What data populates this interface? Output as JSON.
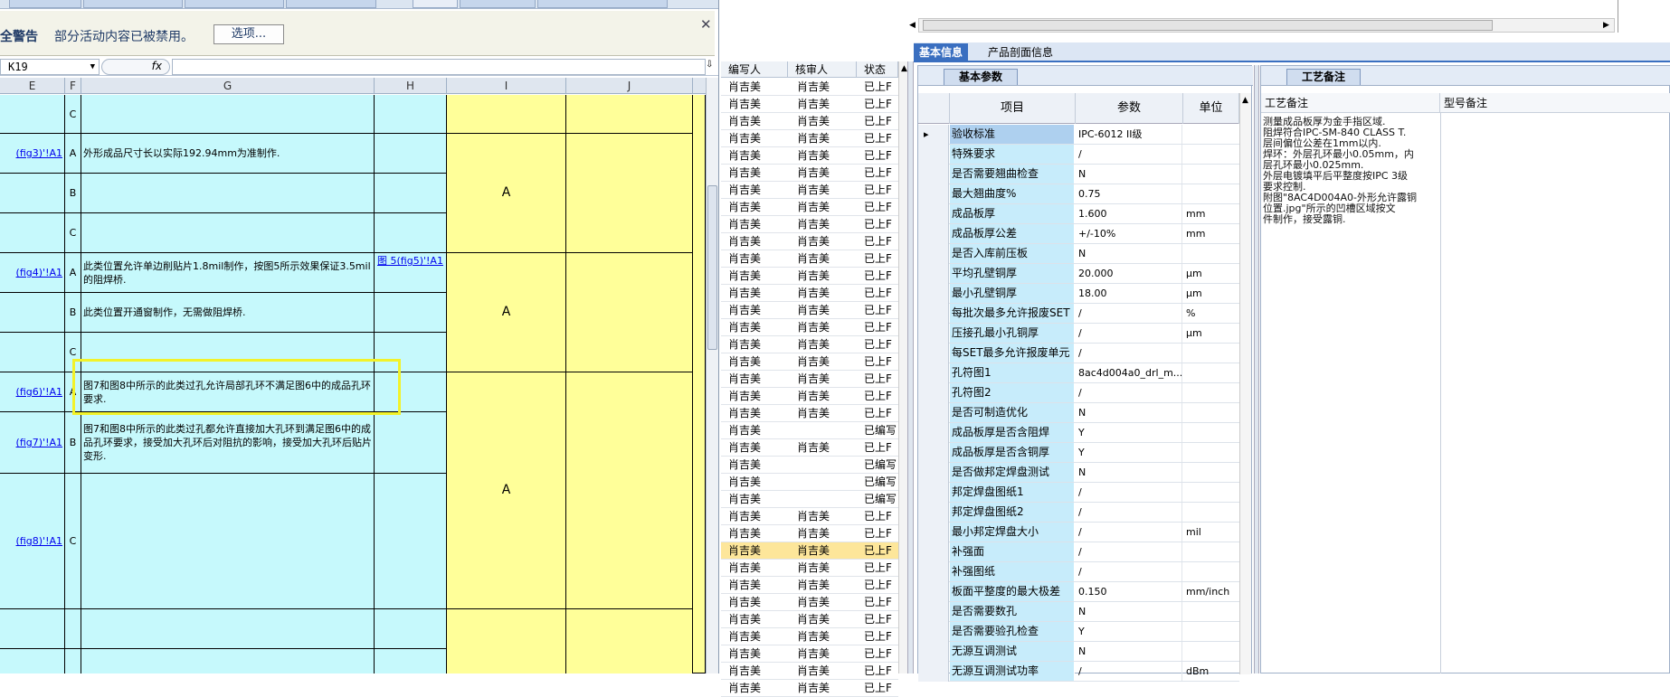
{
  "excel": {
    "security": {
      "title": "安全警告",
      "message": "部分活动内容已被禁用。",
      "options_label": "选项...",
      "close_glyph": "✕"
    },
    "name_box": "K19",
    "fx_label": "fx",
    "columns": [
      "E",
      "F",
      "G",
      "H",
      "I",
      "J"
    ],
    "rows": [
      {
        "e": "",
        "f": "C",
        "g": "",
        "h": ""
      },
      {
        "e": "(fig3)'!A1",
        "f": "A",
        "g": "外形成品尺寸长以实际192.94mm为准制作.",
        "h": ""
      },
      {
        "e": "",
        "f": "B",
        "g": "",
        "h": ""
      },
      {
        "e": "",
        "f": "C",
        "g": "",
        "h": ""
      },
      {
        "e": "(fig4)'!A1",
        "f": "A",
        "g": "此类位置允许单边削贴片1.8mil制作，按图5所示效果保证3.5mil的阻焊桥.",
        "h": "图 5(fig5)'!A1"
      },
      {
        "e": "",
        "f": "B",
        "g": "此类位置开通窗制作，无需做阻焊桥.",
        "h": ""
      },
      {
        "e": "",
        "f": "C",
        "g": "",
        "h": ""
      },
      {
        "e": "(fig6)'!A1",
        "f": "A",
        "g": "图7和图8中所示的此类过孔允许局部孔环不满足图6中的成品孔环要求.",
        "h": ""
      },
      {
        "e": "(fig7)'!A1",
        "f": "B",
        "g": "图7和图8中所示的此类过孔都允许直接加大孔环到满足图6中的成品孔环要求，接受加大孔环后对阻抗的影响，接受加大孔环后贴片变形.",
        "h": ""
      },
      {
        "e": "(fig8)'!A1",
        "f": "C",
        "g": "",
        "h": ""
      },
      {
        "e": "",
        "f": "",
        "g": "",
        "h": ""
      },
      {
        "e": "",
        "f": "",
        "g": "",
        "h": ""
      }
    ],
    "grade_labels": [
      "A",
      "A",
      "A"
    ]
  },
  "list": {
    "headers": [
      "编写人",
      "核审人",
      "状态"
    ],
    "rows": [
      [
        "肖吉美",
        "肖吉美",
        "已上F"
      ],
      [
        "肖吉美",
        "肖吉美",
        "已上F"
      ],
      [
        "肖吉美",
        "肖吉美",
        "已上F"
      ],
      [
        "肖吉美",
        "肖吉美",
        "已上F"
      ],
      [
        "肖吉美",
        "肖吉美",
        "已上F"
      ],
      [
        "肖吉美",
        "肖吉美",
        "已上F"
      ],
      [
        "肖吉美",
        "肖吉美",
        "已上F"
      ],
      [
        "肖吉美",
        "肖吉美",
        "已上F"
      ],
      [
        "肖吉美",
        "肖吉美",
        "已上F"
      ],
      [
        "肖吉美",
        "肖吉美",
        "已上F"
      ],
      [
        "肖吉美",
        "肖吉美",
        "已上F"
      ],
      [
        "肖吉美",
        "肖吉美",
        "已上F"
      ],
      [
        "肖吉美",
        "肖吉美",
        "已上F"
      ],
      [
        "肖吉美",
        "肖吉美",
        "已上F"
      ],
      [
        "肖吉美",
        "肖吉美",
        "已上F"
      ],
      [
        "肖吉美",
        "肖吉美",
        "已上F"
      ],
      [
        "肖吉美",
        "肖吉美",
        "已上F"
      ],
      [
        "肖吉美",
        "肖吉美",
        "已上F"
      ],
      [
        "肖吉美",
        "肖吉美",
        "已上F"
      ],
      [
        "肖吉美",
        "肖吉美",
        "已上F"
      ],
      [
        "肖吉美",
        "",
        "已编写"
      ],
      [
        "肖吉美",
        "肖吉美",
        "已上F"
      ],
      [
        "肖吉美",
        "",
        "已编写"
      ],
      [
        "肖吉美",
        "",
        "已编写"
      ],
      [
        "肖吉美",
        "",
        "已编写"
      ],
      [
        "肖吉美",
        "肖吉美",
        "已上F"
      ],
      [
        "肖吉美",
        "肖吉美",
        "已上F"
      ],
      [
        "肖吉美",
        "肖吉美",
        "已上F"
      ],
      [
        "肖吉美",
        "肖吉美",
        "已上F"
      ],
      [
        "肖吉美",
        "肖吉美",
        "已上F"
      ],
      [
        "肖吉美",
        "肖吉美",
        "已上F"
      ],
      [
        "肖吉美",
        "肖吉美",
        "已上F"
      ],
      [
        "肖吉美",
        "肖吉美",
        "已上F"
      ],
      [
        "肖吉美",
        "肖吉美",
        "已上F"
      ],
      [
        "肖吉美",
        "肖吉美",
        "已上F"
      ],
      [
        "肖吉美",
        "肖吉美",
        "已上F"
      ]
    ],
    "selected_index": 27
  },
  "tabs": {
    "basic": "基本信息",
    "section": "产品剖面信息"
  },
  "params": {
    "title": "基本参数",
    "headers": [
      "项目",
      "参数",
      "单位"
    ],
    "rows": [
      [
        "验收标准",
        "IPC-6012 II级",
        ""
      ],
      [
        "特殊要求",
        "/",
        ""
      ],
      [
        "是否需要翘曲检查",
        "N",
        ""
      ],
      [
        "最大翘曲度%",
        "0.75",
        ""
      ],
      [
        "成品板厚",
        "1.600",
        "mm"
      ],
      [
        "成品板厚公差",
        "+/-10%",
        "mm"
      ],
      [
        "是否入库前压板",
        "N",
        ""
      ],
      [
        "平均孔壁铜厚",
        "20.000",
        "μm"
      ],
      [
        "最小孔壁铜厚",
        "18.00",
        "μm"
      ],
      [
        "每批次最多允许报废SET",
        "/",
        "%"
      ],
      [
        "压接孔最小孔铜厚",
        "/",
        "μm"
      ],
      [
        "每SET最多允许报废单元",
        "/",
        ""
      ],
      [
        "孔符图1",
        "8ac4d004a0_drl_m...",
        ""
      ],
      [
        "孔符图2",
        "/",
        ""
      ],
      [
        "是否可制造优化",
        "N",
        ""
      ],
      [
        "成品板厚是否含阻焊",
        "Y",
        ""
      ],
      [
        "成品板厚是否含铜厚",
        "Y",
        ""
      ],
      [
        "是否做邦定焊盘测试",
        "N",
        ""
      ],
      [
        "邦定焊盘图纸1",
        "/",
        ""
      ],
      [
        "邦定焊盘图纸2",
        "/",
        ""
      ],
      [
        "最小邦定焊盘大小",
        "/",
        "mil"
      ],
      [
        "补强面",
        "/",
        ""
      ],
      [
        "补强图纸",
        "/",
        ""
      ],
      [
        "板面平整度的最大极差",
        "0.150",
        "mm/inch"
      ],
      [
        "是否需要数孔",
        "N",
        ""
      ],
      [
        "是否需要验孔检查",
        "Y",
        ""
      ],
      [
        "无源互调测试",
        "N",
        ""
      ],
      [
        "无源互调测试功率",
        "/",
        "dBm"
      ]
    ]
  },
  "notes": {
    "title": "工艺备注",
    "headers": [
      "工艺备注",
      "型号备注"
    ],
    "lines": [
      "测量成品板厚为金手指区域.",
      "阻焊符合IPC-SM-840 CLASS T.",
      "层间偏位公差在1mm以内.",
      "焊环：外层孔环最小0.05mm，内",
      "层孔环最小0.025mm.",
      "外层电镀填平后平整度按IPC 3级",
      "要求控制.",
      "附图\"8AC4D004A0-外形允许露铜",
      "位置.jpg\"所示的凹槽区域按文",
      "件制作，接受露铜."
    ]
  }
}
